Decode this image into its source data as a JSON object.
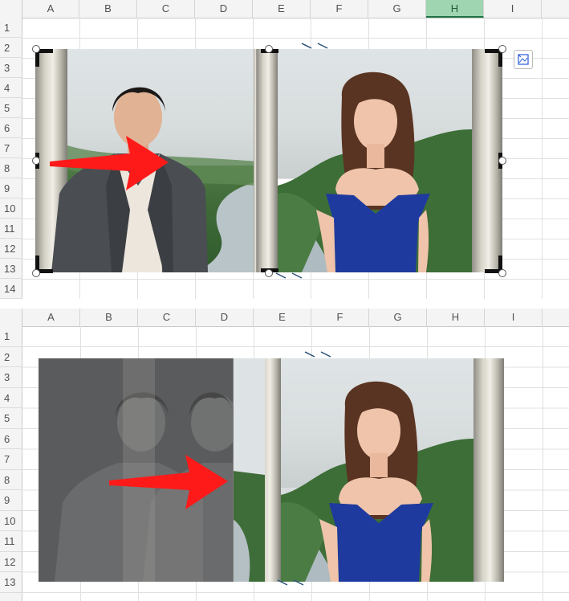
{
  "columns": [
    "A",
    "B",
    "C",
    "D",
    "E",
    "F",
    "G",
    "H",
    "I"
  ],
  "selected_column": "H",
  "rows": [
    "1",
    "2",
    "3",
    "4",
    "5",
    "6",
    "7",
    "8",
    "9",
    "10",
    "11",
    "12",
    "13",
    "14"
  ],
  "bottom_rows": [
    "1",
    "2",
    "3",
    "4",
    "5",
    "6",
    "7",
    "8",
    "9",
    "10",
    "11",
    "12",
    "13"
  ],
  "icons": {
    "layout_options": "layout-options-icon",
    "arrow": "red-arrow",
    "crop_handles": "crop-handle-icon"
  },
  "colors": {
    "selected_header": "#9fd5b0",
    "arrow": "#ff1a1a",
    "dress": "#1f3a9e"
  }
}
